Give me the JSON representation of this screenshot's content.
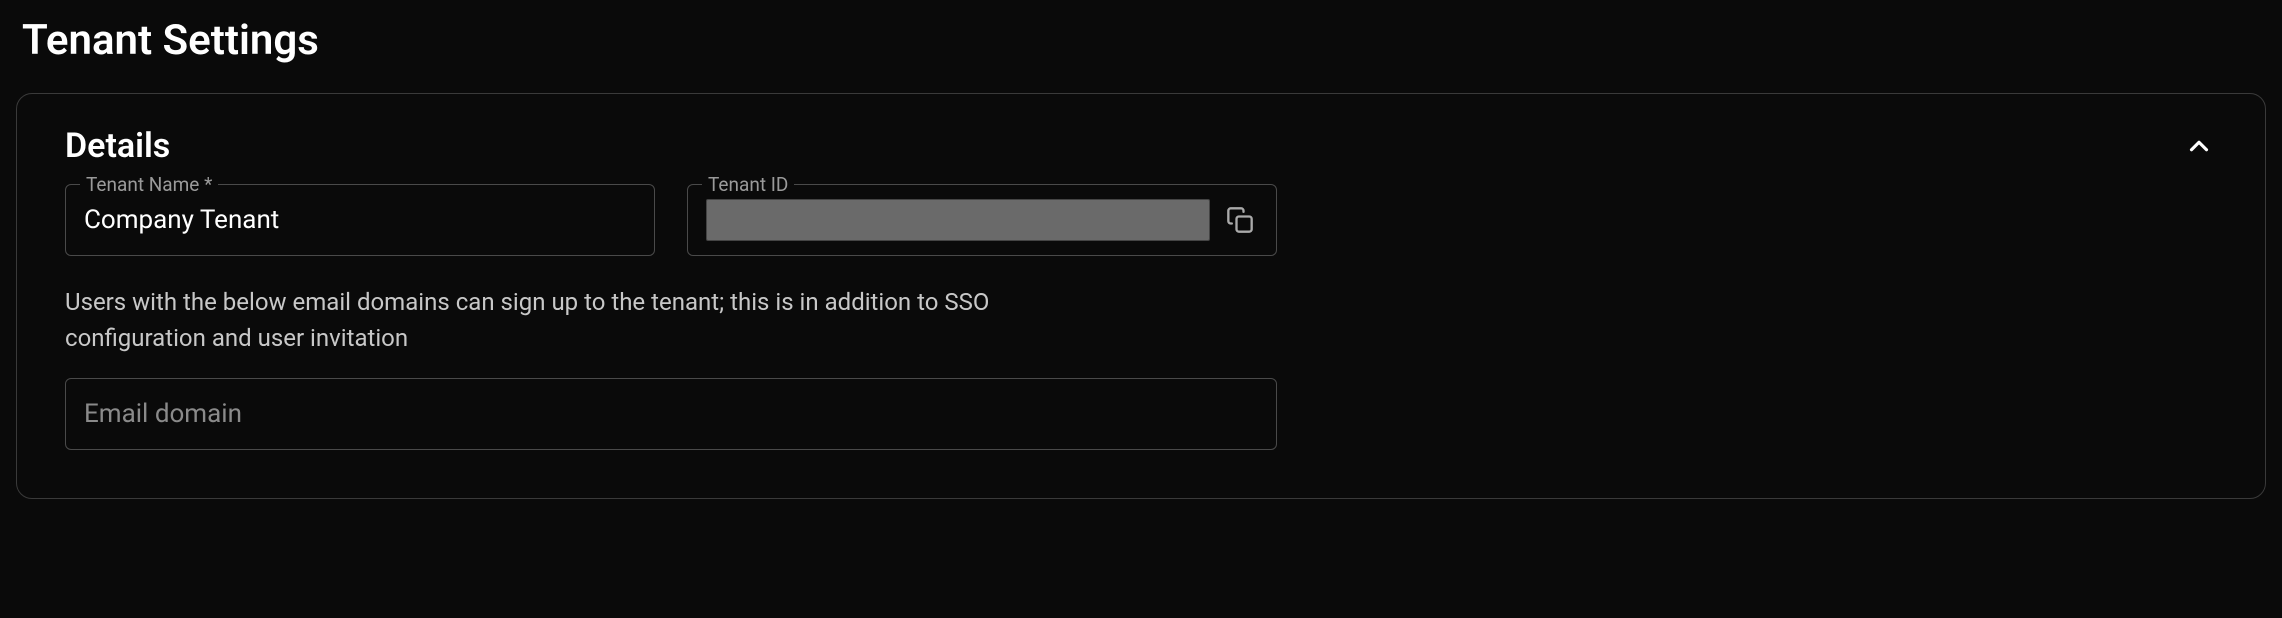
{
  "page": {
    "title": "Tenant Settings"
  },
  "details": {
    "section_title": "Details",
    "tenant_name": {
      "label": "Tenant Name *",
      "value": "Company Tenant"
    },
    "tenant_id": {
      "label": "Tenant ID",
      "value": ""
    },
    "email_domain_help": "Users with the below email domains can sign up to the tenant; this is in addition to SSO configuration and user invitation",
    "email_domain": {
      "placeholder": "Email domain",
      "value": ""
    }
  }
}
